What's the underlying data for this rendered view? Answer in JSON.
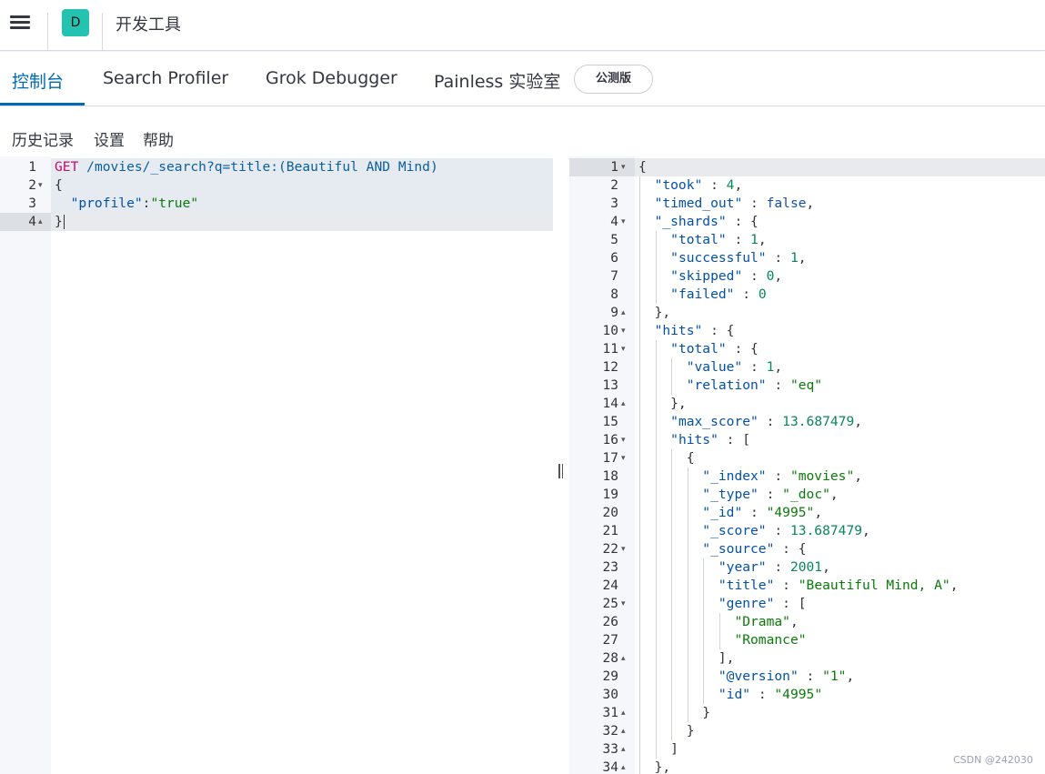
{
  "header": {
    "menu_icon": "hamburger-menu-icon",
    "space_letter": "D",
    "title": "开发工具"
  },
  "tabs": [
    {
      "label": "控制台",
      "active": true
    },
    {
      "label": "Search Profiler",
      "active": false
    },
    {
      "label": "Grok Debugger",
      "active": false
    },
    {
      "label": "Painless 实验室",
      "active": false,
      "badge": "公测版"
    }
  ],
  "submenu": {
    "history": "历史记录",
    "settings": "设置",
    "help": "帮助"
  },
  "request_editor": {
    "lines": [
      {
        "n": "1",
        "fold": "",
        "tokens": [
          {
            "t": "GET ",
            "c": "m"
          },
          {
            "t": "/movies/_search?q=title:(Beautiful AND Mind)",
            "c": "u"
          }
        ]
      },
      {
        "n": "2",
        "fold": "open",
        "tokens": [
          {
            "t": "{",
            "c": "p"
          }
        ]
      },
      {
        "n": "3",
        "fold": "",
        "tokens": [
          {
            "t": "  ",
            "c": "p"
          },
          {
            "t": "\"profile\"",
            "c": "k"
          },
          {
            "t": ":",
            "c": "p"
          },
          {
            "t": "\"true\"",
            "c": "s"
          }
        ]
      },
      {
        "n": "4",
        "fold": "close",
        "tokens": [
          {
            "t": "}",
            "c": "p"
          }
        ]
      }
    ],
    "actions": {
      "run_icon": "play-icon",
      "settings_icon": "wrench-icon"
    }
  },
  "response_editor": {
    "lines": [
      {
        "n": "1",
        "fold": "open",
        "tokens": [
          {
            "t": "{",
            "c": "p"
          }
        ]
      },
      {
        "n": "2",
        "fold": "",
        "tokens": [
          {
            "t": "  ",
            "c": "p"
          },
          {
            "t": "\"took\"",
            "c": "k"
          },
          {
            "t": " : ",
            "c": "p"
          },
          {
            "t": "4",
            "c": "n"
          },
          {
            "t": ",",
            "c": "p"
          }
        ]
      },
      {
        "n": "3",
        "fold": "",
        "tokens": [
          {
            "t": "  ",
            "c": "p"
          },
          {
            "t": "\"timed_out\"",
            "c": "k"
          },
          {
            "t": " : ",
            "c": "p"
          },
          {
            "t": "false",
            "c": "c"
          },
          {
            "t": ",",
            "c": "p"
          }
        ]
      },
      {
        "n": "4",
        "fold": "open",
        "tokens": [
          {
            "t": "  ",
            "c": "p"
          },
          {
            "t": "\"_shards\"",
            "c": "k"
          },
          {
            "t": " : {",
            "c": "p"
          }
        ]
      },
      {
        "n": "5",
        "fold": "",
        "tokens": [
          {
            "t": "    ",
            "c": "p"
          },
          {
            "t": "\"total\"",
            "c": "k"
          },
          {
            "t": " : ",
            "c": "p"
          },
          {
            "t": "1",
            "c": "n"
          },
          {
            "t": ",",
            "c": "p"
          }
        ]
      },
      {
        "n": "6",
        "fold": "",
        "tokens": [
          {
            "t": "    ",
            "c": "p"
          },
          {
            "t": "\"successful\"",
            "c": "k"
          },
          {
            "t": " : ",
            "c": "p"
          },
          {
            "t": "1",
            "c": "n"
          },
          {
            "t": ",",
            "c": "p"
          }
        ]
      },
      {
        "n": "7",
        "fold": "",
        "tokens": [
          {
            "t": "    ",
            "c": "p"
          },
          {
            "t": "\"skipped\"",
            "c": "k"
          },
          {
            "t": " : ",
            "c": "p"
          },
          {
            "t": "0",
            "c": "n"
          },
          {
            "t": ",",
            "c": "p"
          }
        ]
      },
      {
        "n": "8",
        "fold": "",
        "tokens": [
          {
            "t": "    ",
            "c": "p"
          },
          {
            "t": "\"failed\"",
            "c": "k"
          },
          {
            "t": " : ",
            "c": "p"
          },
          {
            "t": "0",
            "c": "n"
          }
        ]
      },
      {
        "n": "9",
        "fold": "close",
        "tokens": [
          {
            "t": "  },",
            "c": "p"
          }
        ]
      },
      {
        "n": "10",
        "fold": "open",
        "tokens": [
          {
            "t": "  ",
            "c": "p"
          },
          {
            "t": "\"hits\"",
            "c": "k"
          },
          {
            "t": " : {",
            "c": "p"
          }
        ]
      },
      {
        "n": "11",
        "fold": "open",
        "tokens": [
          {
            "t": "    ",
            "c": "p"
          },
          {
            "t": "\"total\"",
            "c": "k"
          },
          {
            "t": " : {",
            "c": "p"
          }
        ]
      },
      {
        "n": "12",
        "fold": "",
        "tokens": [
          {
            "t": "      ",
            "c": "p"
          },
          {
            "t": "\"value\"",
            "c": "k"
          },
          {
            "t": " : ",
            "c": "p"
          },
          {
            "t": "1",
            "c": "n"
          },
          {
            "t": ",",
            "c": "p"
          }
        ]
      },
      {
        "n": "13",
        "fold": "",
        "tokens": [
          {
            "t": "      ",
            "c": "p"
          },
          {
            "t": "\"relation\"",
            "c": "k"
          },
          {
            "t": " : ",
            "c": "p"
          },
          {
            "t": "\"eq\"",
            "c": "s"
          }
        ]
      },
      {
        "n": "14",
        "fold": "close",
        "tokens": [
          {
            "t": "    },",
            "c": "p"
          }
        ]
      },
      {
        "n": "15",
        "fold": "",
        "tokens": [
          {
            "t": "    ",
            "c": "p"
          },
          {
            "t": "\"max_score\"",
            "c": "k"
          },
          {
            "t": " : ",
            "c": "p"
          },
          {
            "t": "13.687479",
            "c": "n"
          },
          {
            "t": ",",
            "c": "p"
          }
        ]
      },
      {
        "n": "16",
        "fold": "open",
        "tokens": [
          {
            "t": "    ",
            "c": "p"
          },
          {
            "t": "\"hits\"",
            "c": "k"
          },
          {
            "t": " : [",
            "c": "p"
          }
        ]
      },
      {
        "n": "17",
        "fold": "open",
        "tokens": [
          {
            "t": "      {",
            "c": "p"
          }
        ]
      },
      {
        "n": "18",
        "fold": "",
        "tokens": [
          {
            "t": "        ",
            "c": "p"
          },
          {
            "t": "\"_index\"",
            "c": "k"
          },
          {
            "t": " : ",
            "c": "p"
          },
          {
            "t": "\"movies\"",
            "c": "s"
          },
          {
            "t": ",",
            "c": "p"
          }
        ]
      },
      {
        "n": "19",
        "fold": "",
        "tokens": [
          {
            "t": "        ",
            "c": "p"
          },
          {
            "t": "\"_type\"",
            "c": "k"
          },
          {
            "t": " : ",
            "c": "p"
          },
          {
            "t": "\"_doc\"",
            "c": "s"
          },
          {
            "t": ",",
            "c": "p"
          }
        ]
      },
      {
        "n": "20",
        "fold": "",
        "tokens": [
          {
            "t": "        ",
            "c": "p"
          },
          {
            "t": "\"_id\"",
            "c": "k"
          },
          {
            "t": " : ",
            "c": "p"
          },
          {
            "t": "\"4995\"",
            "c": "s"
          },
          {
            "t": ",",
            "c": "p"
          }
        ]
      },
      {
        "n": "21",
        "fold": "",
        "tokens": [
          {
            "t": "        ",
            "c": "p"
          },
          {
            "t": "\"_score\"",
            "c": "k"
          },
          {
            "t": " : ",
            "c": "p"
          },
          {
            "t": "13.687479",
            "c": "n"
          },
          {
            "t": ",",
            "c": "p"
          }
        ]
      },
      {
        "n": "22",
        "fold": "open",
        "tokens": [
          {
            "t": "        ",
            "c": "p"
          },
          {
            "t": "\"_source\"",
            "c": "k"
          },
          {
            "t": " : {",
            "c": "p"
          }
        ]
      },
      {
        "n": "23",
        "fold": "",
        "tokens": [
          {
            "t": "          ",
            "c": "p"
          },
          {
            "t": "\"year\"",
            "c": "k"
          },
          {
            "t": " : ",
            "c": "p"
          },
          {
            "t": "2001",
            "c": "n"
          },
          {
            "t": ",",
            "c": "p"
          }
        ]
      },
      {
        "n": "24",
        "fold": "",
        "tokens": [
          {
            "t": "          ",
            "c": "p"
          },
          {
            "t": "\"title\"",
            "c": "k"
          },
          {
            "t": " : ",
            "c": "p"
          },
          {
            "t": "\"Beautiful Mind, A\"",
            "c": "s"
          },
          {
            "t": ",",
            "c": "p"
          }
        ]
      },
      {
        "n": "25",
        "fold": "open",
        "tokens": [
          {
            "t": "          ",
            "c": "p"
          },
          {
            "t": "\"genre\"",
            "c": "k"
          },
          {
            "t": " : [",
            "c": "p"
          }
        ]
      },
      {
        "n": "26",
        "fold": "",
        "tokens": [
          {
            "t": "            ",
            "c": "p"
          },
          {
            "t": "\"Drama\"",
            "c": "s"
          },
          {
            "t": ",",
            "c": "p"
          }
        ]
      },
      {
        "n": "27",
        "fold": "",
        "tokens": [
          {
            "t": "            ",
            "c": "p"
          },
          {
            "t": "\"Romance\"",
            "c": "s"
          }
        ]
      },
      {
        "n": "28",
        "fold": "close",
        "tokens": [
          {
            "t": "          ],",
            "c": "p"
          }
        ]
      },
      {
        "n": "29",
        "fold": "",
        "tokens": [
          {
            "t": "          ",
            "c": "p"
          },
          {
            "t": "\"@version\"",
            "c": "k"
          },
          {
            "t": " : ",
            "c": "p"
          },
          {
            "t": "\"1\"",
            "c": "s"
          },
          {
            "t": ",",
            "c": "p"
          }
        ]
      },
      {
        "n": "30",
        "fold": "",
        "tokens": [
          {
            "t": "          ",
            "c": "p"
          },
          {
            "t": "\"id\"",
            "c": "k"
          },
          {
            "t": " : ",
            "c": "p"
          },
          {
            "t": "\"4995\"",
            "c": "s"
          }
        ]
      },
      {
        "n": "31",
        "fold": "close",
        "tokens": [
          {
            "t": "        }",
            "c": "p"
          }
        ]
      },
      {
        "n": "32",
        "fold": "close",
        "tokens": [
          {
            "t": "      }",
            "c": "p"
          }
        ]
      },
      {
        "n": "33",
        "fold": "close",
        "tokens": [
          {
            "t": "    ]",
            "c": "p"
          }
        ]
      },
      {
        "n": "34",
        "fold": "close",
        "tokens": [
          {
            "t": "  },",
            "c": "p"
          }
        ]
      }
    ]
  },
  "resize_icon": "vertical-resize-handle-icon",
  "watermark": "CSDN @242030",
  "colors": {
    "accent": "#006bb4",
    "space_badge": "#24c2b0",
    "method": "#c80a68",
    "key": "#0451a5",
    "string": "#0b7a0b",
    "number": "#098658"
  }
}
